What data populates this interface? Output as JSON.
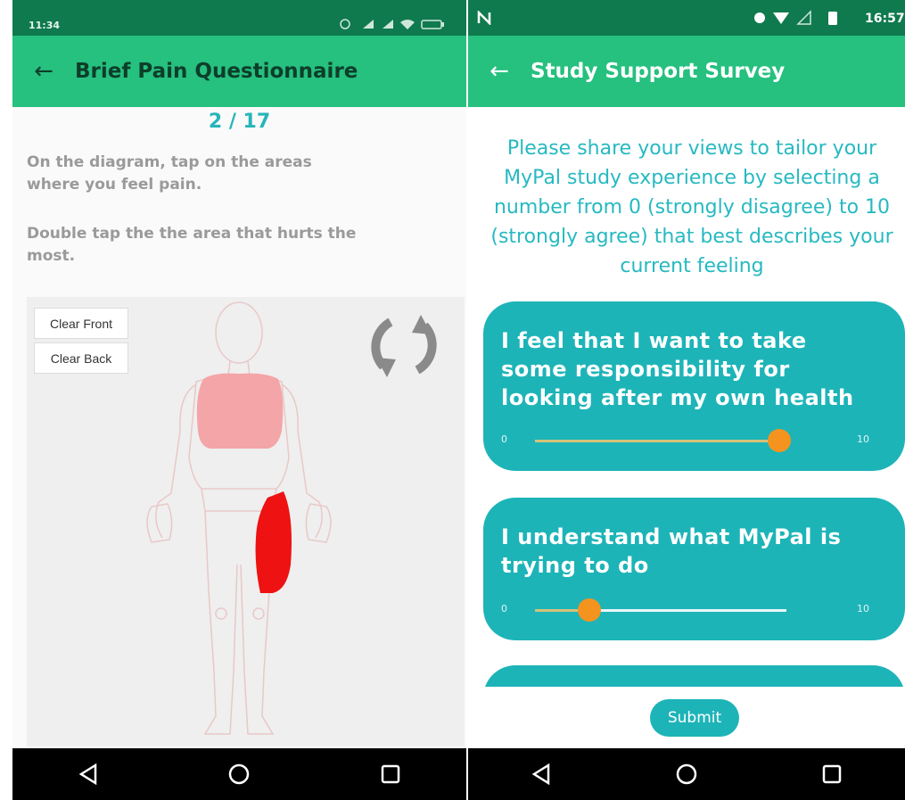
{
  "left": {
    "status_time": "11:34",
    "title": "Brief Pain Questionnaire",
    "progress": "2 / 17",
    "instruction1": "On the diagram, tap on the areas where you feel pain.",
    "instruction2": "Double tap the the area that hurts the most.",
    "clear_front": "Clear Front",
    "clear_back": "Clear Back"
  },
  "right": {
    "status_time": "16:57",
    "title": "Study Support Survey",
    "intro": "Please share your views to tailor your MyPal study experience by selecting a number from 0 (strongly disagree) to 10 (strongly agree) that best describes your current feeling",
    "questions": [
      {
        "text": "I feel that I want to take some responsibility for looking after my own health",
        "min": "0",
        "max": "10",
        "value": 9
      },
      {
        "text": "I understand what MyPal is trying to do",
        "min": "0",
        "max": "10",
        "value": 2
      }
    ],
    "submit": "Submit"
  },
  "colors": {
    "appbar": "#26c07f",
    "statusbar": "#0f7a4d",
    "teal": "#1db4b8",
    "thumb": "#f5931f",
    "pain_marked": "#f4a5a8",
    "pain_worst": "#ee1212"
  }
}
